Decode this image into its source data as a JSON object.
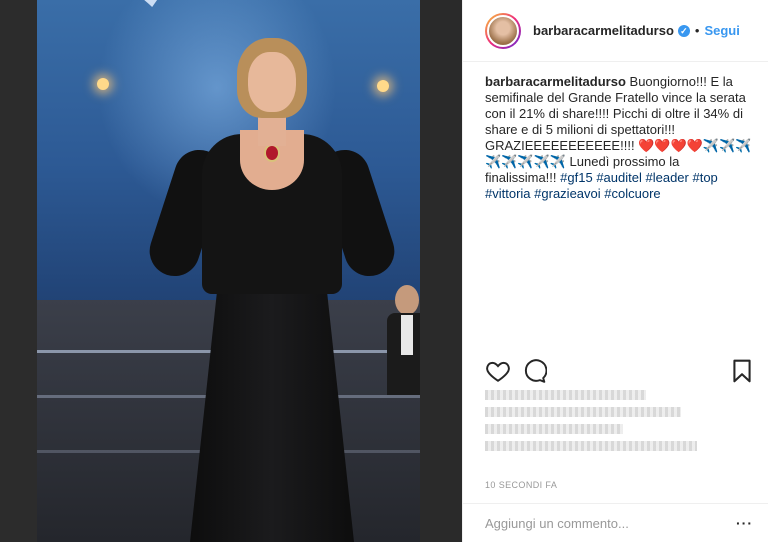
{
  "post": {
    "username": "barbaracarmelitadurso",
    "verified_icon": "verified-badge-icon",
    "separator": "•",
    "follow_label": "Segui"
  },
  "caption": {
    "username": "barbaracarmelitadurso",
    "line1": " Buongiorno!!! E la semifinale del Grande Fratello vince la serata con il 21% di share!!!! Picchi di oltre il 34% di share e di 5 milioni di spettatori!!! GRAZIEEEEEEEEEEE!!!! ",
    "hearts": "❤️❤️❤️❤️",
    "planes": "✈️✈️✈️✈️✈️✈️✈️✈️",
    "line2": " Lunedì prossimo la finalissima!!! ",
    "hashtags": [
      "#gf15",
      "#auditel",
      "#leader",
      "#top",
      "#vittoria",
      "#grazieavoi",
      "#colcuore"
    ]
  },
  "actions": {
    "like_icon": "heart-outline-icon",
    "comment_icon": "comment-bubble-icon",
    "save_icon": "bookmark-icon"
  },
  "timestamp": "10 SECONDI FA",
  "comment": {
    "placeholder": "Aggiungi un commento...",
    "more_label": "···"
  },
  "colors": {
    "accent": "#3897f0",
    "text": "#262626",
    "muted": "#999999",
    "hashtag": "#003569"
  }
}
